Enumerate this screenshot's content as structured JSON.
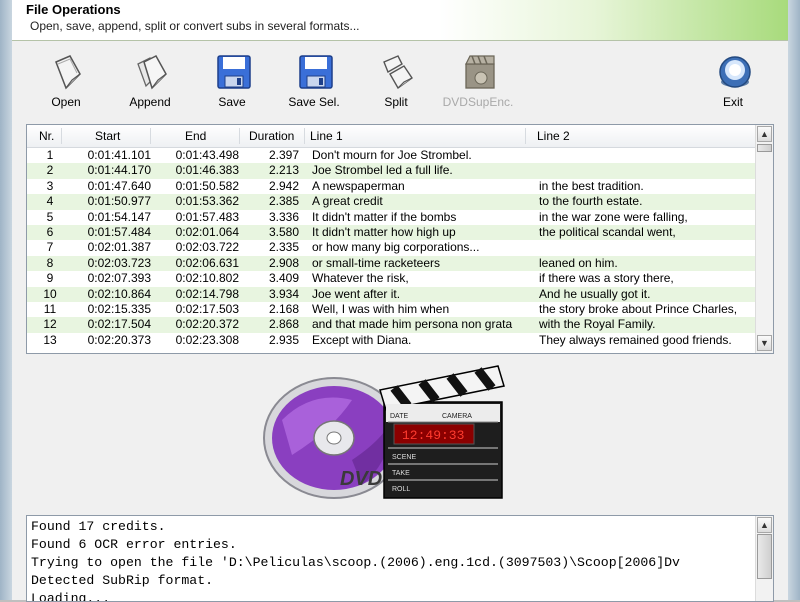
{
  "header": {
    "title": "File Operations",
    "subtitle": "Open, save, append, split or convert subs in several formats..."
  },
  "toolbar": {
    "open": "Open",
    "append": "Append",
    "save": "Save",
    "save_sel": "Save Sel.",
    "split": "Split",
    "dvdsubenc": "DVDSupEnc.",
    "exit": "Exit"
  },
  "grid": {
    "columns": {
      "nr": "Nr.",
      "start": "Start",
      "end": "End",
      "duration": "Duration",
      "line1": "Line 1",
      "line2": "Line 2"
    },
    "rows": [
      {
        "nr": "1",
        "start": "0:01:41.101",
        "end": "0:01:43.498",
        "duration": "2.397",
        "line1": "Don't mourn for Joe Strombel.",
        "line2": ""
      },
      {
        "nr": "2",
        "start": "0:01:44.170",
        "end": "0:01:46.383",
        "duration": "2.213",
        "line1": "Joe Strombel led a full life.",
        "line2": ""
      },
      {
        "nr": "3",
        "start": "0:01:47.640",
        "end": "0:01:50.582",
        "duration": "2.942",
        "line1": "A newspaperman",
        "line2": "in the best tradition."
      },
      {
        "nr": "4",
        "start": "0:01:50.977",
        "end": "0:01:53.362",
        "duration": "2.385",
        "line1": "A great credit",
        "line2": "to the fourth estate."
      },
      {
        "nr": "5",
        "start": "0:01:54.147",
        "end": "0:01:57.483",
        "duration": "3.336",
        "line1": "It didn't matter if the bombs",
        "line2": "in the war zone were falling,"
      },
      {
        "nr": "6",
        "start": "0:01:57.484",
        "end": "0:02:01.064",
        "duration": "3.580",
        "line1": "It didn't matter how high up",
        "line2": "the political scandal went,"
      },
      {
        "nr": "7",
        "start": "0:02:01.387",
        "end": "0:02:03.722",
        "duration": "2.335",
        "line1": "or how many big corporations...",
        "line2": ""
      },
      {
        "nr": "8",
        "start": "0:02:03.723",
        "end": "0:02:06.631",
        "duration": "2.908",
        "line1": "or small-time racketeers",
        "line2": "leaned on him."
      },
      {
        "nr": "9",
        "start": "0:02:07.393",
        "end": "0:02:10.802",
        "duration": "3.409",
        "line1": "Whatever the risk,",
        "line2": "if there was a story there,"
      },
      {
        "nr": "10",
        "start": "0:02:10.864",
        "end": "0:02:14.798",
        "duration": "3.934",
        "line1": "Joe went after it.",
        "line2": "And he usually got it."
      },
      {
        "nr": "11",
        "start": "0:02:15.335",
        "end": "0:02:17.503",
        "duration": "2.168",
        "line1": "Well, I was with him when",
        "line2": "the story broke about Prince Charles,"
      },
      {
        "nr": "12",
        "start": "0:02:17.504",
        "end": "0:02:20.372",
        "duration": "2.868",
        "line1": "and that made him persona non grata",
        "line2": "with the Royal Family."
      },
      {
        "nr": "13",
        "start": "0:02:20.373",
        "end": "0:02:23.308",
        "duration": "2.935",
        "line1": "Except with Diana.",
        "line2": "They always remained good friends."
      }
    ]
  },
  "logo": {
    "dvd_text": "DVD",
    "clapper_labels": [
      "DATE",
      "CAMERA",
      "SCENE",
      "TAKE",
      "ROLL"
    ],
    "timecode": "12:49:33"
  },
  "log": {
    "lines": [
      "Found 17 credits.",
      "Found 6 OCR error entries.",
      "Trying to open the file 'D:\\Peliculas\\scoop.(2006).eng.1cd.(3097503)\\Scoop[2006]Dv",
      "Detected SubRip format.",
      "Loading..."
    ]
  }
}
